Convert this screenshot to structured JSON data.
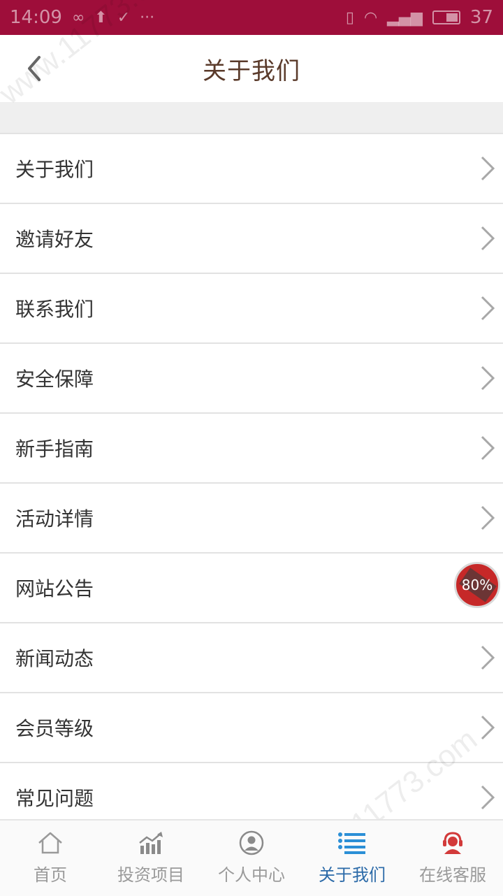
{
  "status_bar": {
    "time": "14:09",
    "battery": "37"
  },
  "header": {
    "title": "关于我们"
  },
  "menu": {
    "items": [
      {
        "label": "关于我们"
      },
      {
        "label": "邀请好友"
      },
      {
        "label": "联系我们"
      },
      {
        "label": "安全保障"
      },
      {
        "label": "新手指南"
      },
      {
        "label": "活动详情"
      },
      {
        "label": "网站公告"
      },
      {
        "label": "新闻动态"
      },
      {
        "label": "会员等级"
      },
      {
        "label": "常见问题"
      }
    ]
  },
  "floating_badge": {
    "text": "80%"
  },
  "tabbar": {
    "tabs": [
      {
        "label": "首页",
        "icon": "home-icon"
      },
      {
        "label": "投资项目",
        "icon": "chart-icon"
      },
      {
        "label": "个人中心",
        "icon": "user-icon"
      },
      {
        "label": "关于我们",
        "icon": "list-icon",
        "active": true
      },
      {
        "label": "在线客服",
        "icon": "customer-service-icon"
      }
    ]
  },
  "watermark": {
    "text": "www.11773.com"
  },
  "colors": {
    "status_bar": "#9e0e3a",
    "active_tab": "#2b6aa8",
    "title": "#5a3a2a"
  }
}
